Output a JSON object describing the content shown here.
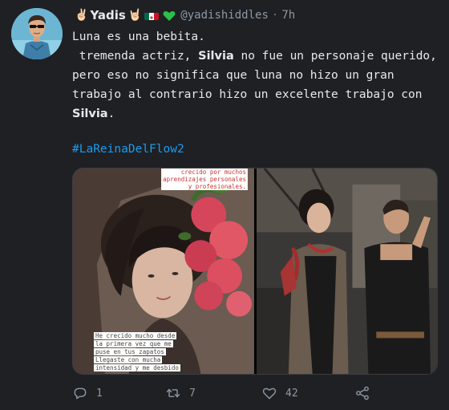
{
  "tweet": {
    "display_name": "Yadis",
    "emoji_prefix": "✌🏻",
    "emoji_suffix": "🤘🏻",
    "handle": "@yadishiddles",
    "separator": "·",
    "time": "7h",
    "line1": "Luna es una bebita.",
    "line2_pre": " tremenda actriz, ",
    "line2_bold": "Silvia",
    "line2_post": " no fue un personaje querido,",
    "line3": "pero eso no significa que luna no hizo un gran",
    "line4": "trabajo al contrario hizo un excelente trabajo con",
    "line5_bold": "Silvia",
    "line5_post": ".",
    "hashtag": "#LaReinaDelFlow2"
  },
  "media": {
    "photo1_caption_top": [
      "crecido por muchos",
      "aprendizajes personales",
      "y profesionales."
    ],
    "photo1_caption_bottom": [
      "He crecido mucho desde",
      "la primera vez que me",
      "puse en tus zapatos",
      "Llegaste con mucha",
      "intensidad y me desbido"
    ]
  },
  "actions": {
    "reply_count": "1",
    "retweet_count": "7",
    "like_count": "42"
  },
  "colors": {
    "background": "#1f2023",
    "text": "#e7e9ea",
    "muted": "#8b98a5",
    "link": "#1d9bf0",
    "heart_green": "#2bbf4b"
  }
}
